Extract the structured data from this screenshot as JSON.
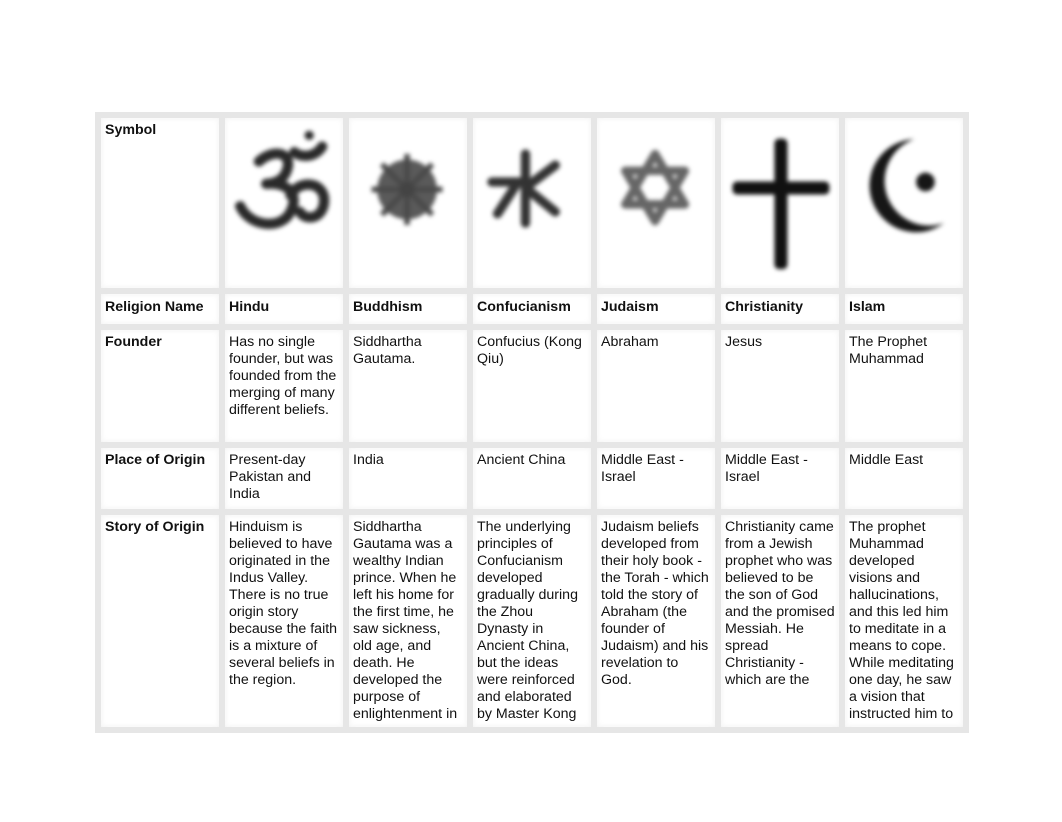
{
  "table": {
    "row_labels": {
      "symbol": "Symbol",
      "religion_name": "Religion Name",
      "founder": "Founder",
      "place_of_origin": "Place of Origin",
      "story_of_origin": "Story of Origin"
    },
    "religions": [
      {
        "symbol_icon": "om-icon",
        "name": "Hindu",
        "founder": "Has no single founder, but was founded from the merging of many different beliefs.",
        "place_of_origin": "Present-day Pakistan and India",
        "story_of_origin": "Hinduism is believed to have originated in the Indus Valley. There is no true origin story because the faith is a mixture of several beliefs in the region."
      },
      {
        "symbol_icon": "dharma-wheel-icon",
        "name": "Buddhism",
        "founder": "Siddhartha Gautama.",
        "place_of_origin": "India",
        "story_of_origin": "Siddhartha Gautama was a wealthy Indian prince. When he left his home for the first time, he saw sickness, old age, and death. He developed the purpose of enlightenment in"
      },
      {
        "symbol_icon": "confucian-water-symbol-icon",
        "name": "Confucianism",
        "founder": "Confucius (Kong Qiu)",
        "place_of_origin": "Ancient China",
        "story_of_origin": "The underlying principles of Confucianism developed gradually during the Zhou Dynasty in Ancient China, but the ideas were reinforced and elaborated by Master Kong"
      },
      {
        "symbol_icon": "star-of-david-icon",
        "name": "Judaism",
        "founder": "Abraham",
        "place_of_origin": "Middle East - Israel",
        "story_of_origin": "Judaism beliefs developed from their holy book - the Torah - which told the story of Abraham (the founder of Judaism) and his revelation to God."
      },
      {
        "symbol_icon": "cross-icon",
        "name": "Christianity",
        "founder": "Jesus",
        "place_of_origin": "Middle East - Israel",
        "story_of_origin": "Christianity came from a Jewish prophet who was believed to be the son of God and the promised Messiah. He spread Christianity - which are the"
      },
      {
        "symbol_icon": "crescent-icon",
        "name": "Islam",
        "founder": "The Prophet Muhammad",
        "place_of_origin": "Middle East",
        "story_of_origin": "The prophet Muhammad developed visions and hallucinations, and this led him to meditate in a means to cope. While meditating one day, he saw a vision that instructed him to"
      }
    ]
  }
}
